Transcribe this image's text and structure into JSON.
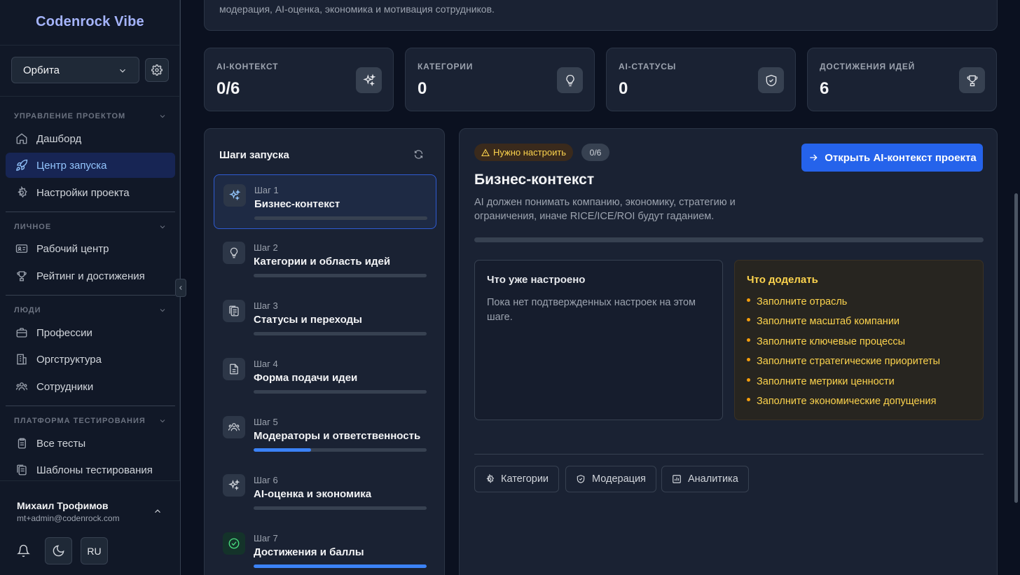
{
  "sidebar": {
    "brand": "Codenrock Vibe",
    "project_select": "Орбита",
    "groups": [
      {
        "label": "УПРАВЛЕНИЕ ПРОЕКТОМ",
        "items": [
          "Дашборд",
          "Центр запуска",
          "Настройки проекта"
        ]
      },
      {
        "label": "ЛИЧНОЕ",
        "items": [
          "Рабочий центр",
          "Рейтинг и достижения"
        ]
      },
      {
        "label": "ЛЮДИ",
        "items": [
          "Профессии",
          "Оргструктура",
          "Сотрудники"
        ]
      },
      {
        "label": "ПЛАТФОРМА ТЕСТИРОВАНИЯ",
        "items": [
          "Все тесты",
          "Шаблоны тестирования"
        ]
      }
    ],
    "active_item": "Центр запуска",
    "user": {
      "name": "Михаил Трофимов",
      "email": "mt+admin@codenrock.com"
    },
    "lang": "RU"
  },
  "header": {
    "description": "модерация, AI-оценка, экономика и мотивация сотрудников."
  },
  "stats": [
    {
      "label": "AI-КОНТЕКСТ",
      "value": "0/6",
      "icon": "sparkles-icon"
    },
    {
      "label": "КАТЕГОРИИ",
      "value": "0",
      "icon": "lightbulb-icon"
    },
    {
      "label": "AI-СТАТУСЫ",
      "value": "0",
      "icon": "shield-check-icon"
    },
    {
      "label": "ДОСТИЖЕНИЯ ИДЕЙ",
      "value": "6",
      "icon": "trophy-icon"
    }
  ],
  "steps_panel": {
    "title": "Шаги запуска",
    "steps": [
      {
        "num": "Шаг 1",
        "name": "Бизнес-контекст",
        "progress": 0
      },
      {
        "num": "Шаг 2",
        "name": "Категории и область идей",
        "progress": 0
      },
      {
        "num": "Шаг 3",
        "name": "Статусы и переходы",
        "progress": 0
      },
      {
        "num": "Шаг 4",
        "name": "Форма подачи идеи",
        "progress": 0
      },
      {
        "num": "Шаг 5",
        "name": "Модераторы и ответственность",
        "progress": 0.33
      },
      {
        "num": "Шаг 6",
        "name": "AI-оценка и экономика",
        "progress": 0
      },
      {
        "num": "Шаг 7",
        "name": "Достижения и баллы",
        "progress": 1
      }
    ]
  },
  "detail": {
    "badge": "Нужно настроить",
    "count": "0/6",
    "open_button": "Открыть AI-контекст проекта",
    "title": "Бизнес-контекст",
    "description": "AI должен понимать компанию, экономику, стратегию и ограничения, иначе RICE/ICE/ROI будут гаданием.",
    "progress": 0,
    "done_title": "Что уже настроено",
    "done_text": "Пока нет подтвержденных настроек на этом шаге.",
    "todo_title": "Что доделать",
    "todo_items": [
      "Заполните отрасль",
      "Заполните масштаб компании",
      "Заполните ключевые процессы",
      "Заполните стратегические приоритеты",
      "Заполните метрики ценности",
      "Заполните экономические допущения"
    ],
    "links": [
      "Категории",
      "Модерация",
      "Аналитика"
    ]
  },
  "colors": {
    "accent": "#2563eb",
    "brand": "#a5b4fc",
    "warning": "#fcd34d",
    "active_nav_bg": "#172554"
  }
}
